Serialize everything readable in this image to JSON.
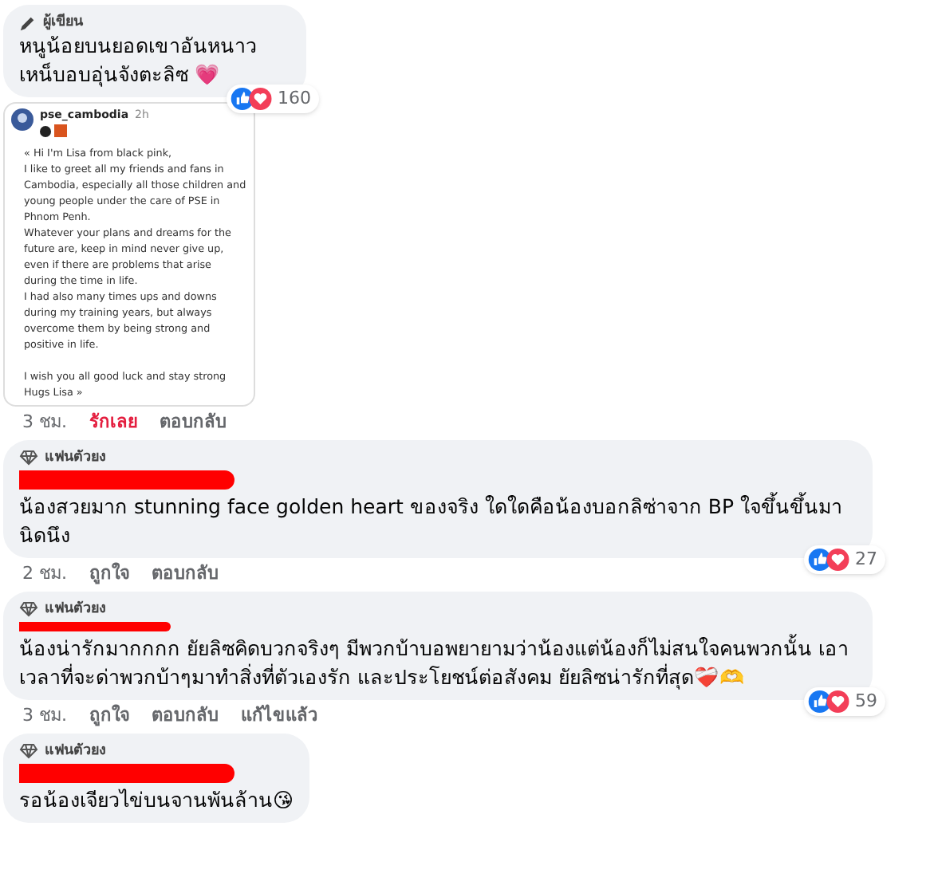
{
  "comments": [
    {
      "badge": {
        "kind": "author",
        "text": "ผู้เขียน"
      },
      "redacted_name": false,
      "text": "หนูน้อยบนยอดเขาอันหนาวเหน็บอบอุ่นจังตะลิซ 💗",
      "post": {
        "user": "pse_cambodia",
        "time": "2h",
        "lines": [
          "« Hi I'm Lisa from black pink,",
          "I like to greet all my friends and fans in Cambodia, especially all those children and young people under the care of PSE in Phnom Penh.",
          "Whatever your plans and dreams for the future are, keep in mind never give up, even if there are problems that arise during the time in life.",
          "I had also many times ups and downs during my training years, but always overcome them by being strong and positive in life."
        ],
        "signoff": [
          "I wish you all good luck and stay strong",
          "Hugs Lisa »"
        ]
      },
      "time": "3 ชม.",
      "actions": [
        {
          "label": "รักเลย",
          "selected": true
        },
        {
          "label": "ตอบกลับ",
          "selected": false
        }
      ],
      "reactions": "160"
    },
    {
      "badge": {
        "kind": "fan",
        "text": "แฟนตัวยง"
      },
      "redacted_name": true,
      "text": "น้องสวยมาก stunning face golden heart ของจริง ใดใดคือน้องบอกลิซ่าจาก BP ใจขึ้นขึ้นมานิดนึง",
      "time": "2 ชม.",
      "actions": [
        {
          "label": "ถูกใจ",
          "selected": false
        },
        {
          "label": "ตอบกลับ",
          "selected": false
        }
      ],
      "reactions": "27"
    },
    {
      "badge": {
        "kind": "fan",
        "text": "แฟนตัวยง"
      },
      "redacted_name": true,
      "text": "น้องน่ารักมากกกก ยัยลิซคิดบวกจริงๆ มีพวกบ้าบอพยายามว่าน้องแต่น้องก็ไม่สนใจคนพวกนั้น เอาเวลาที่จะด่าพวกบ้าๆมาทำสิ่งที่ตัวเองรัก และประโยชน์ต่อสังคม ยัยลิซน่ารักที่สุด❤️‍🩹🫶",
      "time": "3 ชม.",
      "actions": [
        {
          "label": "ถูกใจ",
          "selected": false
        },
        {
          "label": "ตอบกลับ",
          "selected": false
        },
        {
          "label": "แก้ไขแล้ว",
          "selected": false
        }
      ],
      "reactions": "59"
    },
    {
      "badge": {
        "kind": "fan",
        "text": "แฟนตัวยง"
      },
      "redacted_name": true,
      "text": "รอน้องเจียวไข่บนจานพันล้าน😘"
    }
  ]
}
